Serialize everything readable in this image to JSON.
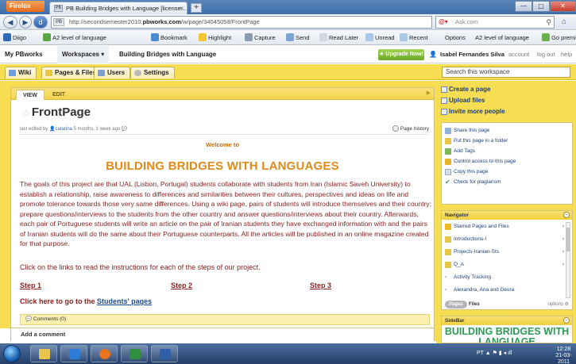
{
  "browser": {
    "app_button": "Firefox",
    "tab_title": "PB Building Bridges with Language [license...",
    "tab_favicon": "PB",
    "new_tab": "+",
    "url_badge": "PB",
    "url_prefix": "http://secondsemester2010.",
    "url_domain": "pbworks.com",
    "url_path": "/w/page/34045058/FrontPage",
    "search_placeholder": "Ask.com",
    "search_engine_icon": "ask-icon"
  },
  "toolbar": {
    "diigo": "Diigo",
    "a2": "A2 level of language",
    "bookmark": "Bookmark",
    "highlight": "Highlight",
    "capture": "Capture",
    "send": "Send",
    "read_later": "Read Later",
    "unread": "Unread",
    "recent": "Recent",
    "options": "Options",
    "a2_search": "A2  level  of  language",
    "go_premium": "Go premiu"
  },
  "pb_header": {
    "my_pbworks": "My PBworks",
    "workspaces": "Workspaces",
    "breadcrumb": "Building Bridges with Language",
    "upgrade": "Upgrade Now!",
    "user": "Isabel Fernandes Silva",
    "account": "account",
    "logout": "log out",
    "help": "help"
  },
  "ws_tabs": {
    "wiki": "Wiki",
    "pages_files": "Pages & Files",
    "users": "Users",
    "settings": "Settings",
    "search_placeholder": "Search this workspace"
  },
  "page": {
    "tab_view": "VIEW",
    "tab_edit": "EDIT",
    "title": "FrontPage",
    "meta_prefix": "last edited by",
    "meta_user": "catarina",
    "meta_suffix": "5 months, 1 week ago",
    "page_history": "Page history",
    "welcome": "Welcome to",
    "heading": "BUILDING BRIDGES WITH LANGUAGES",
    "body": "The goals of this project are that UAL (Lisbon, Portugal) students collaborate with students from Iran (Islamic Saveh University) to establish a relationship, raise awareness to differences and similarities between their cultures, perspectives and ideas on life and promote tolerance towards those very same differences. Using a wiki page, pairs of students will introduce themselves and their country; prepare questions/interviews to the students from the other country and answer questions/interviews about their country.  Afterwards, each pair of Portuguese students will write an article on the pair of Iranian students they have exchanged information with and the pairs of Iranian students will do the same about their Portuguese counterparts. All the articles will be published in an online magazine created for that purpose.",
    "instructions": "Click on the links to read the instructions for each of the steps of our project.",
    "step1": "Step 1",
    "step2": "Step 2",
    "step3": "Step 3",
    "students_prefix": "Click here to go to the ",
    "students_link": "Students' pages",
    "comments": "Comments (0)",
    "add_comment": "Add a comment"
  },
  "sidebar": {
    "create_page": "Create a page",
    "upload_files": "Upload files",
    "invite": "Invite more people",
    "share": "Share this page",
    "put_folder": "Put this page in a folder",
    "add_tags": "Add Tags",
    "control_access": "Control access to this page",
    "copy": "Copy this page",
    "plagiarism": "Check for plagiarism"
  },
  "navigator": {
    "title": "Navigator",
    "items": [
      {
        "label": "Starred Pages and Files"
      },
      {
        "label": "Introductions-I"
      },
      {
        "label": "Projects-Iranian-Sts"
      },
      {
        "label": "Q_A"
      },
      {
        "label": "Activity Tracking"
      },
      {
        "label": "Alexandra, Ana and Deura"
      }
    ],
    "pages_pill": "Pages",
    "files_tab": "Files",
    "options": "options"
  },
  "sidebar_panel": {
    "title": "SideBar",
    "big_text": "BUILDING BRIDGES WITH LANGUAGE"
  },
  "taskbar": {
    "tray_text": "PT",
    "time": "12:28",
    "date": "21-03-2011"
  }
}
